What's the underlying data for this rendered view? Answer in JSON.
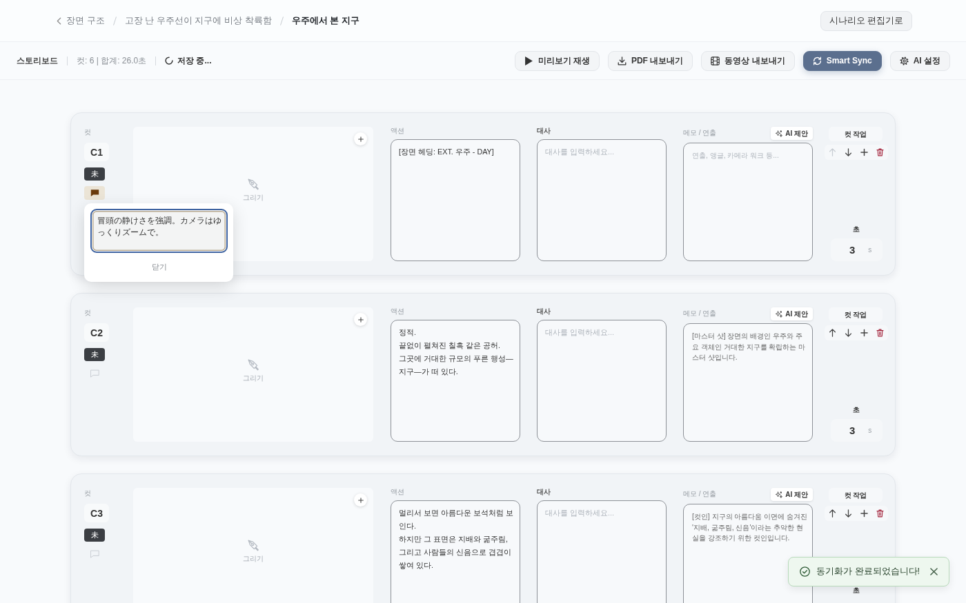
{
  "breadcrumb": {
    "items": [
      {
        "label": "장면 구조",
        "current": false
      },
      {
        "label": "고장 난 우주선이 지구에 비상 착륙함",
        "current": false
      },
      {
        "label": "우주에서 본 지구",
        "current": true
      }
    ]
  },
  "header_button": {
    "label": "시나리오 편집기로"
  },
  "toolbar": {
    "title": "스토리보드",
    "stats": "컷: 6 | 합계: 26.0초",
    "save_status": "저장 중...",
    "buttons": [
      {
        "kind": "play",
        "label": "미리보기 재생",
        "primary": false
      },
      {
        "kind": "download",
        "label": "PDF 내보내기",
        "primary": false
      },
      {
        "kind": "film",
        "label": "동영상 내보내기",
        "primary": false
      },
      {
        "kind": "sync",
        "label": "Smart Sync",
        "primary": true
      },
      {
        "kind": "gear",
        "label": "AI 설정",
        "primary": false
      }
    ]
  },
  "shots": [
    {
      "cut_label": "컷",
      "id": "C1",
      "status": "未",
      "note_open": true,
      "note": {
        "text": "冒頭の静けさを強調。カメラはゆっくりズームで。",
        "close_label": "닫기"
      },
      "drawing_label": "그리기",
      "action_label": "액션",
      "action": "[장면 헤딩: EXT. 우주 - DAY]",
      "dialogue_label": "대사",
      "dialogue_placeholder": "대사를 입력하세요...",
      "memo_label": "메모 / 연출",
      "memo_placeholder": "연출, 앵글, 카메라 워크 등...",
      "ai_label": "AI 제안",
      "actions_label": "컷 작업",
      "up_disabled": true,
      "seconds_label": "초",
      "seconds": "3",
      "unit": "s"
    },
    {
      "cut_label": "컷",
      "id": "C2",
      "status": "未",
      "note_open": false,
      "drawing_label": "그리기",
      "action_label": "액션",
      "action": "정적.\n끝없이 펼쳐진 칠흑 같은 공허.\n그곳에 거대한 규모의 푸른 행성—\n지구—가 떠 있다.",
      "dialogue_label": "대사",
      "dialogue_placeholder": "대사를 입력하세요...",
      "memo_label": "메모 / 연출",
      "memo": "[마스터 샷] 장면의 배경인 우주와 주요 객체인 거대한 지구를 확립하는 마스터 샷입니다.",
      "ai_label": "AI 제안",
      "actions_label": "컷 작업",
      "up_disabled": false,
      "seconds_label": "초",
      "seconds": "3",
      "unit": "s"
    },
    {
      "cut_label": "컷",
      "id": "C3",
      "status": "未",
      "note_open": false,
      "drawing_label": "그리기",
      "action_label": "액션",
      "action": "멀리서 보면 아름다운 보석처럼 보인다.\n하지만 그 표면은 지배와 굶주림, 그리고 사람들의 신음으로 겹겹이 쌓여 있다.",
      "dialogue_label": "대사",
      "dialogue_placeholder": "대사를 입력하세요...",
      "memo_label": "메모 / 연출",
      "memo": "[컷인] 지구의 아름다움 이면에 숨겨진 '지배, 굶주림, 신음'이라는 추악한 현실을 강조하기 위한 컷인입니다.",
      "ai_label": "AI 제안",
      "actions_label": "컷 작업",
      "up_disabled": false,
      "seconds_label": "초"
    }
  ],
  "toast": {
    "message": "동기화가 완료되었습니다!"
  }
}
